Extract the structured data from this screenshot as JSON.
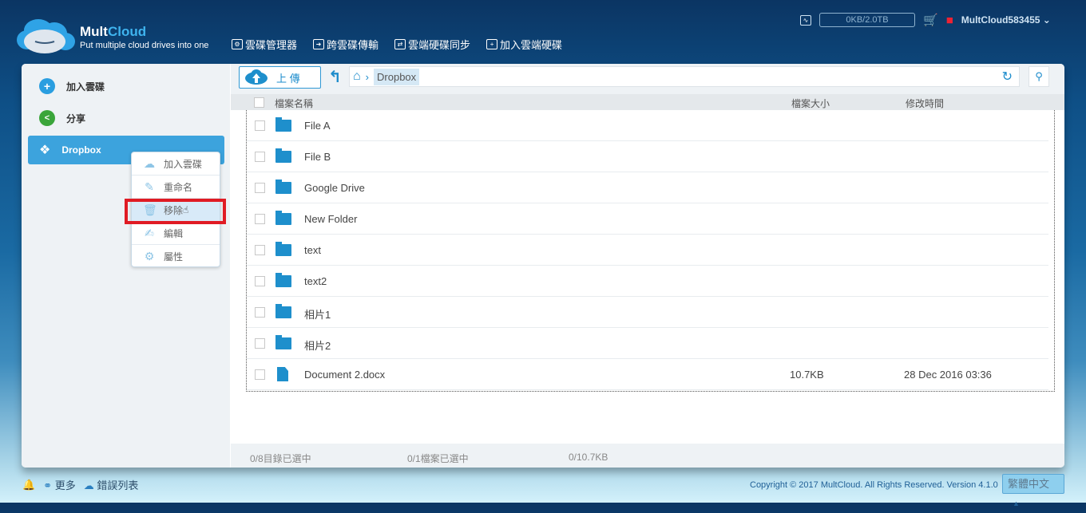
{
  "header": {
    "brand_a": "Mult",
    "brand_b": "Cloud",
    "tagline": "Put multiple cloud drives into one",
    "nav": [
      {
        "label": "雲碟管理器",
        "icon": "gear"
      },
      {
        "label": "跨雲碟傳輸",
        "icon": "arrow"
      },
      {
        "label": "雲端硬碟同步",
        "icon": "sync"
      },
      {
        "label": "加入雲端硬碟",
        "icon": "plus"
      }
    ],
    "quota": "0KB/2.0TB",
    "username": "MultCloud583455"
  },
  "sidebar": {
    "items": [
      {
        "label": "加入雲碟"
      },
      {
        "label": "分享"
      },
      {
        "label": "Dropbox"
      }
    ]
  },
  "context_menu": {
    "items": [
      {
        "label": "加入雲碟"
      },
      {
        "label": "重命名"
      },
      {
        "label": "移除"
      },
      {
        "label": "編輯"
      },
      {
        "label": "屬性"
      }
    ]
  },
  "toolbar": {
    "upload": "上 傳",
    "breadcrumb": "Dropbox"
  },
  "table": {
    "headers": {
      "name": "檔案名稱",
      "size": "檔案大小",
      "modified": "修改時間"
    },
    "rows": [
      {
        "name": "File A",
        "type": "folder",
        "size": "",
        "modified": ""
      },
      {
        "name": "File B",
        "type": "folder",
        "size": "",
        "modified": ""
      },
      {
        "name": "Google Drive",
        "type": "folder",
        "size": "",
        "modified": ""
      },
      {
        "name": "New Folder",
        "type": "folder",
        "size": "",
        "modified": ""
      },
      {
        "name": "text",
        "type": "folder",
        "size": "",
        "modified": ""
      },
      {
        "name": "text2",
        "type": "folder",
        "size": "",
        "modified": ""
      },
      {
        "name": "相片1",
        "type": "folder",
        "size": "",
        "modified": ""
      },
      {
        "name": "相片2",
        "type": "folder",
        "size": "",
        "modified": ""
      },
      {
        "name": "Document 2.docx",
        "type": "file",
        "size": "10.7KB",
        "modified": "28 Dec 2016 03:36"
      }
    ]
  },
  "status": {
    "dirs": "0/8目錄已選中",
    "files": "0/1檔案已選中",
    "size": "0/10.7KB"
  },
  "footer": {
    "more": "更多",
    "errors": "錯誤列表",
    "copyright": "Copyright © 2017 MultCloud. All Rights Reserved. Version 4.1.0",
    "language": "繁體中文"
  }
}
